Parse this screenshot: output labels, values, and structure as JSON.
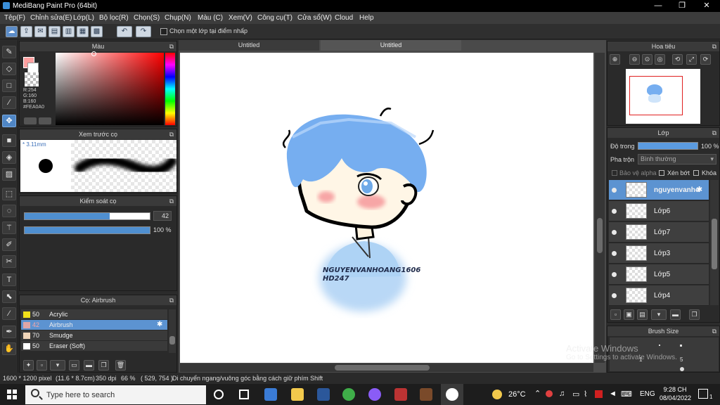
{
  "window": {
    "title": "MediBang Paint Pro (64bit)",
    "minimize": "—",
    "maximize": "❐",
    "close": "✕"
  },
  "menu": [
    "Tệp(F)",
    "Chỉnh sửa(E)",
    "Lớp(L)",
    "Bộ lọc(R)",
    "Chọn(S)",
    "Chụp(N)",
    "Màu (C)",
    "Xem(V)",
    "Công cụ(T)",
    "Cửa sổ(W)",
    "Cloud",
    "Help"
  ],
  "toolbar": {
    "select_one_layer_label": "Chọn một lớp tại điểm nhấp",
    "undo": "↶",
    "redo": "↷"
  },
  "tabs": [
    "Untitled",
    "Untitled"
  ],
  "color_panel": {
    "title": "Màu",
    "r": "R:254",
    "g": "G:160",
    "b": "B:160",
    "hex": "#FEA0A0",
    "fg_color": "#fea0a0"
  },
  "brush_preview": {
    "title": "Xem trước cọ",
    "size": "* 3.11mm"
  },
  "brush_control": {
    "title": "Kiểm soát cọ",
    "size_value": "42",
    "opacity_value": "100 %",
    "size_fill": 0.68,
    "opacity_fill": 1.0
  },
  "brush_list": {
    "title": "Cọ: Airbrush",
    "items": [
      {
        "size": "50",
        "name": "Acrylic",
        "color": "#f2e11a"
      },
      {
        "size": "42",
        "name": "Airbrush",
        "color": "#e0a6a6",
        "selected": true
      },
      {
        "size": "70",
        "name": "Smudge",
        "color": "#f0d5b8"
      },
      {
        "size": "50",
        "name": "Eraser (Soft)",
        "color": "#ffffff"
      }
    ]
  },
  "artwork": {
    "signature_line1": "NGUYENVANHOANG1606",
    "signature_line2": "HD247"
  },
  "navigator": {
    "title": "Hoa tiêu"
  },
  "layer_panel": {
    "title": "Lớp",
    "opacity_label": "Độ trong",
    "opacity_value": "100 %",
    "blend_label": "Pha trộn",
    "blend_value": "Bình thường",
    "protect_alpha": "Bảo vệ alpha",
    "clipping": "Xén bớt",
    "lock": "Khóa",
    "layers": [
      "nguyenvanho",
      "Lớp6",
      "Lớp7",
      "Lớp3",
      "Lớp5",
      "Lớp4"
    ]
  },
  "brush_size_panel": {
    "title": "Brush Size",
    "values": [
      "1",
      "5"
    ]
  },
  "status": {
    "dims": "1600 * 1200 pixel",
    "cm": "(11.6 * 8.7cm)",
    "dpi": "350 dpi",
    "zoom": "66 %",
    "coords": "( 529, 754 )",
    "hint": "Di chuyển ngang/vuông góc bằng cách giữ phím Shift"
  },
  "watermark": {
    "line1": "Activate Windows",
    "line2": "Go to Settings to activate Windows."
  },
  "taskbar": {
    "search_placeholder": "Type here to search",
    "temperature": "26°C",
    "language": "ENG",
    "time": "9:28 CH",
    "date": "08/04/2022",
    "notifications": "1"
  }
}
